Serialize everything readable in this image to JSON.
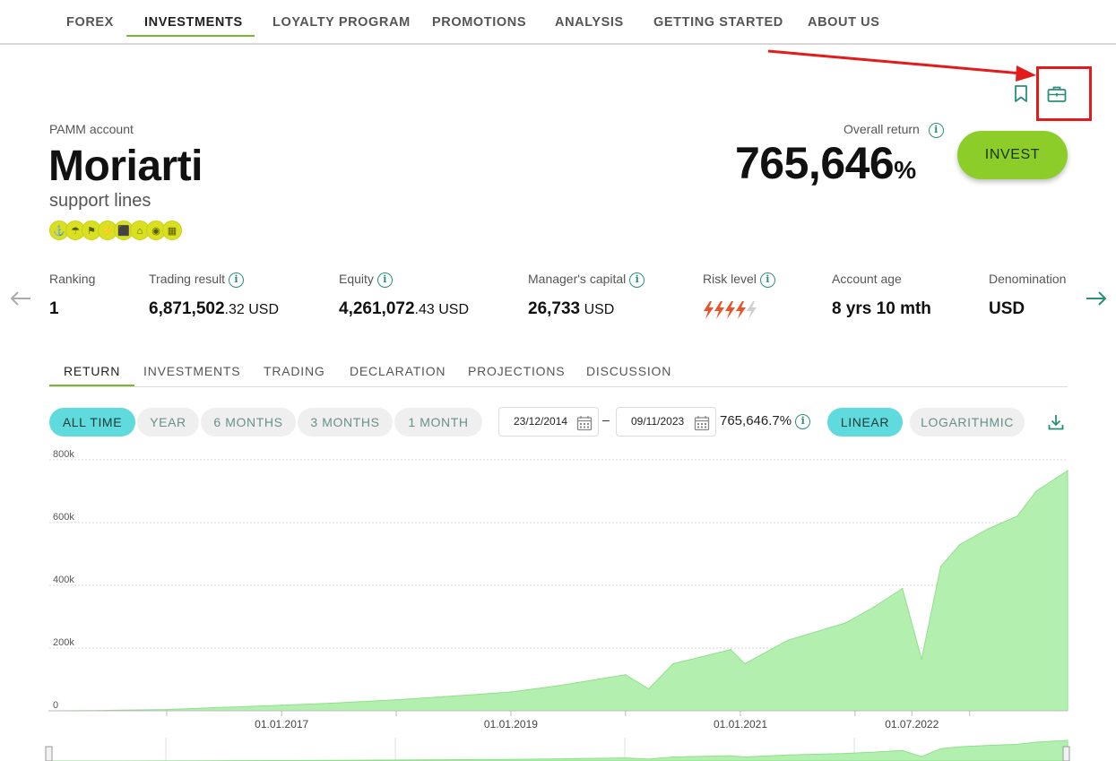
{
  "nav": {
    "items": [
      "FOREX",
      "INVESTMENTS",
      "LOYALTY PROGRAM",
      "PROMOTIONS",
      "ANALYSIS",
      "GETTING STARTED",
      "ABOUT US"
    ],
    "active": "INVESTMENTS"
  },
  "account": {
    "type": "PAMM account",
    "name": "Moriarti",
    "strategy": "support lines",
    "badges": [
      "⚓",
      "☂",
      "⚑",
      "⚡",
      "⬛",
      "⌂",
      "◉",
      "▦"
    ]
  },
  "overall_return": {
    "label": "Overall return",
    "value": "765,646",
    "unit": "%"
  },
  "invest_button": "INVEST",
  "stats": {
    "ranking": {
      "label": "Ranking",
      "value": "1"
    },
    "trading_result": {
      "label": "Trading result",
      "int": "6,871,502",
      "dec": ".32",
      "cur": " USD"
    },
    "equity": {
      "label": "Equity",
      "int": "4,261,072",
      "dec": ".43",
      "cur": " USD"
    },
    "managers_capital": {
      "label": "Manager's capital",
      "int": "26,733",
      "cur": " USD"
    },
    "risk_level": {
      "label": "Risk level",
      "value": 4,
      "max": 5
    },
    "account_age": {
      "label": "Account age",
      "value": "8 yrs 10 mth"
    },
    "denomination": {
      "label": "Denomination",
      "value": "USD"
    }
  },
  "tabs": [
    "RETURN",
    "INVESTMENTS",
    "TRADING",
    "DECLARATION",
    "PROJECTIONS",
    "DISCUSSION"
  ],
  "active_tab": "RETURN",
  "periods": [
    "ALL TIME",
    "YEAR",
    "6 MONTHS",
    "3 MONTHS",
    "1 MONTH"
  ],
  "active_period": "ALL TIME",
  "date_from": "23/12/2014",
  "date_to": "09/11/2023",
  "range_return": "765,646.7%",
  "scales": [
    "LINEAR",
    "LOGARITHMIC"
  ],
  "active_scale": "LINEAR",
  "colors": {
    "accent_green": "#7ab72e",
    "invest_green": "#8ccd2a",
    "teal": "#2a8f7a",
    "pill_active": "#5fdadd",
    "chart_fill": "#b3f0b0",
    "chart_line": "#8ee08a",
    "annotation_red": "#e21b1b",
    "risk_bolt": "#e8532b"
  },
  "icons": [
    "bookmark-icon",
    "briefcase-icon",
    "arrow-left-icon",
    "arrow-right-icon",
    "calendar-icon",
    "download-icon",
    "info-icon",
    "lightning-icon"
  ],
  "chart_data": {
    "type": "area",
    "ylim": [
      0,
      800000
    ],
    "y_ticks": [
      0,
      200000,
      400000,
      600000,
      800000
    ],
    "y_tick_labels": [
      "0",
      "200k",
      "400k",
      "600k",
      "800k"
    ],
    "x_tick_labels": [
      "01.01.2017",
      "01.01.2019",
      "01.01.2021",
      "01.07.2022"
    ],
    "x": [
      "2014-12-23",
      "2015-06-01",
      "2016-01-01",
      "2016-06-01",
      "2017-01-01",
      "2017-06-01",
      "2018-01-01",
      "2018-06-01",
      "2019-01-01",
      "2019-06-01",
      "2020-01-01",
      "2020-03-15",
      "2020-06-01",
      "2020-12-01",
      "2021-01-15",
      "2021-06-01",
      "2021-12-01",
      "2022-03-01",
      "2022-06-01",
      "2022-08-01",
      "2022-10-01",
      "2022-12-01",
      "2023-03-01",
      "2023-06-01",
      "2023-08-01",
      "2023-10-01",
      "2023-11-09"
    ],
    "values": [
      0,
      1000,
      4000,
      10000,
      18000,
      24000,
      35000,
      45000,
      60000,
      80000,
      115000,
      70000,
      150000,
      195000,
      150000,
      225000,
      280000,
      330000,
      390000,
      165000,
      460000,
      530000,
      580000,
      620000,
      700000,
      740000,
      765646
    ]
  }
}
